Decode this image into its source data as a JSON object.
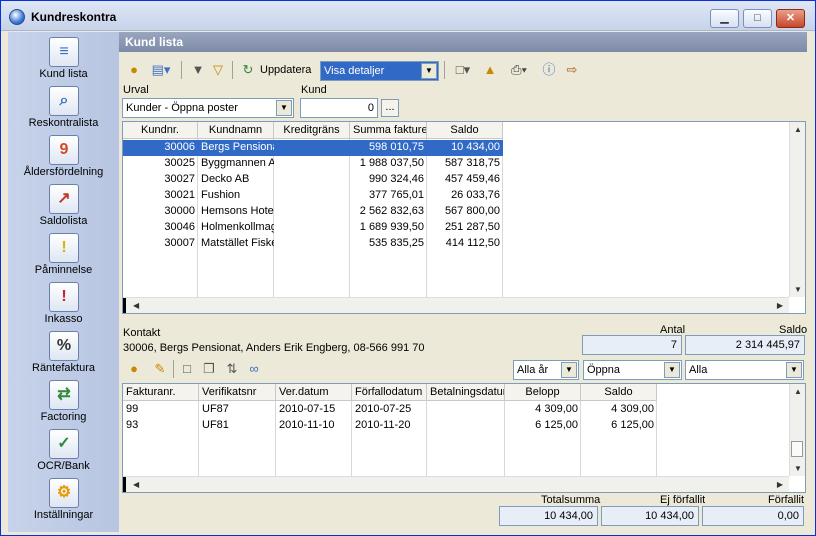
{
  "window": {
    "title": "Kundreskontra",
    "minimize": "▁",
    "maximize": "□",
    "close": "✕"
  },
  "sidebar": {
    "items": [
      {
        "label": "Kund lista",
        "icon": "customer-list-icon",
        "glyph": "≡",
        "color": "#3d6fc4"
      },
      {
        "label": "Reskontralista",
        "icon": "ledger-search-icon",
        "glyph": "⌕",
        "color": "#3d6fc4"
      },
      {
        "label": "Åldersfördelning",
        "icon": "calendar-icon",
        "glyph": "9",
        "color": "#d24a28"
      },
      {
        "label": "Saldolista",
        "icon": "balance-chart-icon",
        "glyph": "↗",
        "color": "#c03a2a"
      },
      {
        "label": "Påminnelse",
        "icon": "reminder-warning-icon",
        "glyph": "!",
        "color": "#e0b000"
      },
      {
        "label": "Inkasso",
        "icon": "collection-warning-icon",
        "glyph": "!",
        "color": "#d02020"
      },
      {
        "label": "Räntefaktura",
        "icon": "interest-invoice-icon",
        "glyph": "%",
        "color": "#333333"
      },
      {
        "label": "Factoring",
        "icon": "factoring-icon",
        "glyph": "⇄",
        "color": "#2f8a3a"
      },
      {
        "label": "OCR/Bank",
        "icon": "ocr-bank-icon",
        "glyph": "✓",
        "color": "#2f8a3a"
      },
      {
        "label": "Inställningar",
        "icon": "settings-icon",
        "glyph": "⚙",
        "color": "#e89a00"
      }
    ]
  },
  "header": {
    "title": "Kund lista"
  },
  "toolbar": {
    "update_label": "Uppdatera",
    "view_value": "Visa detaljer"
  },
  "filter": {
    "urval_label": "Urval",
    "urval_value": "Kunder - Öppna poster",
    "kund_label": "Kund",
    "kund_value": "0",
    "browse": "..."
  },
  "customers": {
    "columns": [
      "Kundnr.",
      "Kundnamn",
      "Kreditgräns",
      "Summa fakturer",
      "Saldo"
    ],
    "rows": [
      {
        "nr": "30006",
        "name": "Bergs Pensiona",
        "credit": "",
        "sum": "598 010,75",
        "saldo": "10 434,00"
      },
      {
        "nr": "30025",
        "name": "Byggmannen A",
        "credit": "",
        "sum": "1 988 037,50",
        "saldo": "587 318,75"
      },
      {
        "nr": "30027",
        "name": "Decko AB",
        "credit": "",
        "sum": "990 324,46",
        "saldo": "457 459,46"
      },
      {
        "nr": "30021",
        "name": "Fushion",
        "credit": "",
        "sum": "377 765,01",
        "saldo": "26 033,76"
      },
      {
        "nr": "30000",
        "name": "Hemsons Hotel",
        "credit": "",
        "sum": "2 562 832,63",
        "saldo": "567 800,00"
      },
      {
        "nr": "30046",
        "name": "Holmenkollmag",
        "credit": "",
        "sum": "1 689 939,50",
        "saldo": "251 287,50"
      },
      {
        "nr": "30007",
        "name": "Matstället Fiske",
        "credit": "",
        "sum": "535 835,25",
        "saldo": "414 112,50"
      }
    ]
  },
  "contact": {
    "label": "Kontakt",
    "value": "30006, Bergs Pensionat, Anders Erik Engberg, 08-566 991 70",
    "antal_label": "Antal",
    "antal_value": "7",
    "saldo_label": "Saldo",
    "saldo_value": "2 314 445,97"
  },
  "invoice_filters": {
    "year": "Alla år",
    "status": "Öppna",
    "type": "Alla"
  },
  "invoices": {
    "columns": [
      "Fakturanr.",
      "Verifikatsnr",
      "Ver.datum",
      "Förfallodatum",
      "Betalningsdatum",
      "Belopp",
      "Saldo"
    ],
    "rows": [
      {
        "nr": "99",
        "ver": "UF87",
        "verdate": "2010-07-15",
        "due": "2010-07-25",
        "paid": "",
        "amount": "4 309,00",
        "saldo": "4 309,00"
      },
      {
        "nr": "93",
        "ver": "UF81",
        "verdate": "2010-11-10",
        "due": "2010-11-20",
        "paid": "",
        "amount": "6 125,00",
        "saldo": "6 125,00"
      }
    ]
  },
  "totals": {
    "total_label": "Totalsumma",
    "total_value": "10 434,00",
    "notdue_label": "Ej förfallit",
    "notdue_value": "10 434,00",
    "due_label": "Förfallit",
    "due_value": "0,00"
  }
}
